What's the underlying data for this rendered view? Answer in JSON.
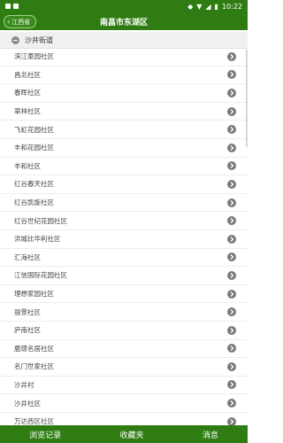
{
  "status_bar": {
    "time": "10:22"
  },
  "app_bar": {
    "back_label": "江西省",
    "title": "南昌市东湖区"
  },
  "section": {
    "title": "沙井街道"
  },
  "list_items": [
    "滨江豪园社区",
    "昌北社区",
    "春晖社区",
    "翠林社区",
    "飞虹花园社区",
    "丰和花园社区",
    "丰和社区",
    "红谷春天社区",
    "红谷凯旋社区",
    "红谷世纪花园社区",
    "洪城比华利社区",
    "汇海社区",
    "江信国际花园社区",
    "理想家园社区",
    "丽景社区",
    "庐南社区",
    "鹿璟名居社区",
    "名门世家社区",
    "沙井村",
    "沙井社区",
    "万达西区社区"
  ],
  "bottom_nav": {
    "history": "浏览记录",
    "favorites": "收藏夹",
    "messages": "消息"
  },
  "colors": {
    "primary_green": "#2f7d12",
    "chevron_gray": "#7a7a7a"
  }
}
